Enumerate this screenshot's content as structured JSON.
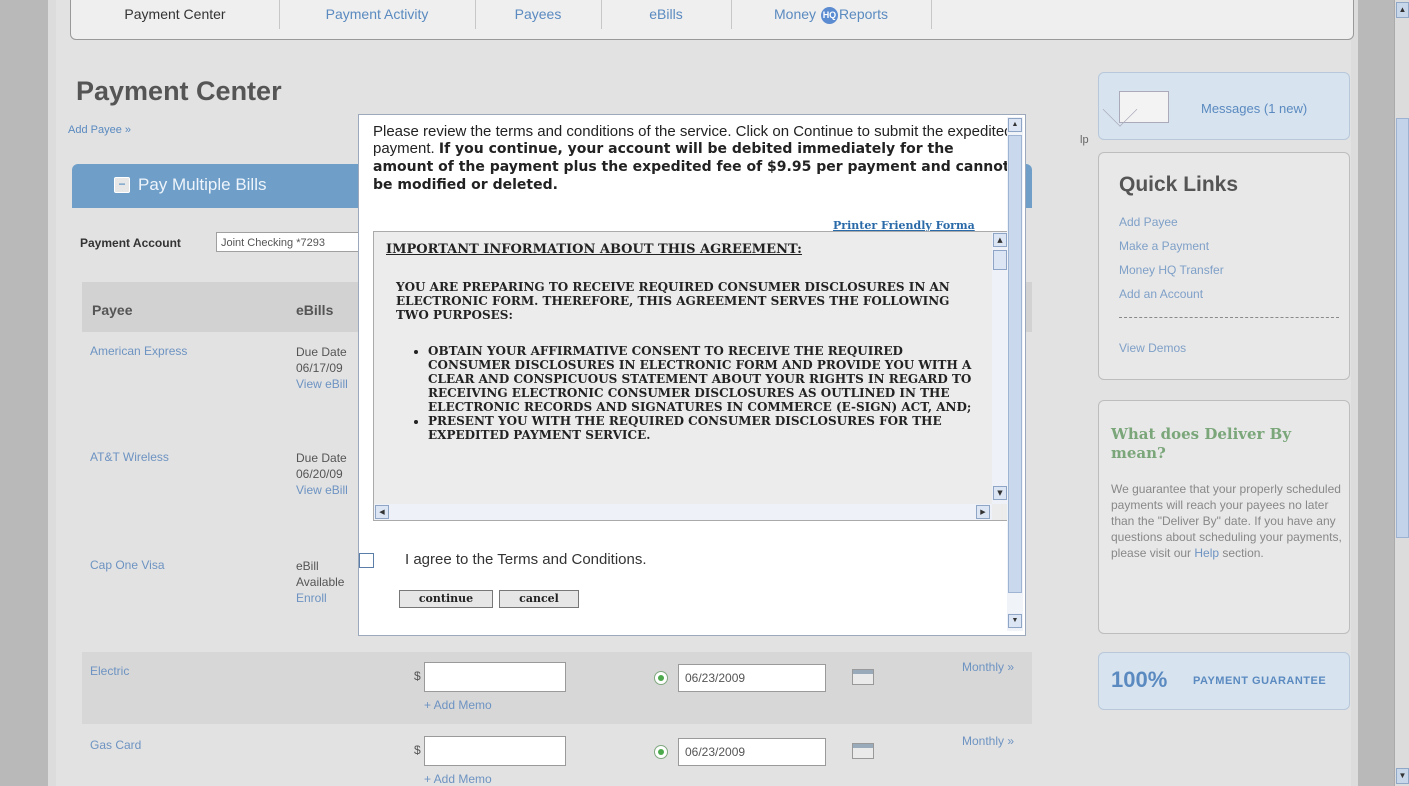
{
  "nav": {
    "tabs": [
      {
        "label": "Payment Center"
      },
      {
        "label": "Payment Activity"
      },
      {
        "label": "Payees"
      },
      {
        "label": "eBills"
      },
      {
        "label_pre": "Money ",
        "badge": "HQ",
        "label_post": "Reports"
      }
    ]
  },
  "page": {
    "title": "Payment Center",
    "add_payee_link": "Add Payee »",
    "help_fragment": "lp",
    "pay_multiple_label": "Pay Multiple Bills",
    "payment_account_label": "Payment Account",
    "payment_account_value": "Joint Checking *7293"
  },
  "table": {
    "headers": {
      "payee": "Payee",
      "ebills": "eBills"
    },
    "rows": [
      {
        "payee": "American Express",
        "ebill_line1": "Due Date",
        "ebill_line2": "06/17/09",
        "ebill_link": "View eBill"
      },
      {
        "payee": "AT&T Wireless",
        "ebill_line1": "Due Date",
        "ebill_line2": "06/20/09",
        "ebill_link": "View eBill"
      },
      {
        "payee": "Cap One Visa",
        "ebill_line1": "eBill",
        "ebill_line2": "Available",
        "ebill_link": "Enroll"
      },
      {
        "payee": "Electric",
        "currency": "$",
        "amount": "",
        "add_memo": "+ Add Memo",
        "date": "06/23/2009",
        "frequency": "Monthly »"
      },
      {
        "payee": "Gas Card",
        "currency": "$",
        "amount": "",
        "add_memo": "+ Add Memo",
        "date": "06/23/2009",
        "frequency": "Monthly »"
      }
    ]
  },
  "sidebar": {
    "messages": "Messages (1 new)",
    "quick_links_title": "Quick Links",
    "quick_links": [
      "Add Payee",
      "Make a Payment",
      "Money HQ Transfer",
      "Add an Account"
    ],
    "view_demos": "View Demos",
    "deliver_by_title": "What does Deliver By mean?",
    "deliver_by_text_pre": "We guarantee that your properly scheduled payments will reach your payees no later than the \"Deliver By\" date. If you have any questions about scheduling your payments, please visit our ",
    "deliver_by_help": "Help",
    "deliver_by_text_post": " section.",
    "guarantee_pct": "100%",
    "guarantee_text": "PAYMENT GUARANTEE"
  },
  "modal": {
    "intro_plain": "Please review the terms and conditions of the service. Click on Continue to submit the expedited payment. ",
    "intro_bold": "If you continue, your account will be debited immediately for the amount of the payment plus the expedited fee of $9.95 per payment and cannot be modified or deleted.",
    "printer_link": "Printer Friendly Forma",
    "agreement_heading": "IMPORTANT INFORMATION ABOUT THIS AGREEMENT:",
    "agreement_para": "YOU ARE PREPARING TO RECEIVE REQUIRED CONSUMER DISCLOSURES IN AN ELECTRONIC FORM. THEREFORE, THIS AGREEMENT SERVES THE FOLLOWING TWO PURPOSES:",
    "agreement_items": [
      "OBTAIN YOUR AFFIRMATIVE CONSENT TO RECEIVE THE REQUIRED CONSUMER DISCLOSURES IN ELECTRONIC FORM AND PROVIDE YOU WITH A CLEAR AND CONSPICUOUS STATEMENT ABOUT YOUR RIGHTS IN REGARD TO RECEIVING ELECTRONIC CONSUMER DISCLOSURES AS OUTLINED IN THE ELECTRONIC RECORDS AND SIGNATURES IN COMMERCE (E-SIGN) ACT, AND;",
      "PRESENT YOU WITH THE REQUIRED CONSUMER DISCLOSURES FOR THE EXPEDITED PAYMENT SERVICE."
    ],
    "agree_label": "I agree to the Terms and Conditions.",
    "continue_label": "continue",
    "cancel_label": "cancel"
  },
  "colors": {
    "accent_blue": "#6f9fc8",
    "link_blue": "#6d93c2",
    "deliver_green": "#7aa67a"
  }
}
